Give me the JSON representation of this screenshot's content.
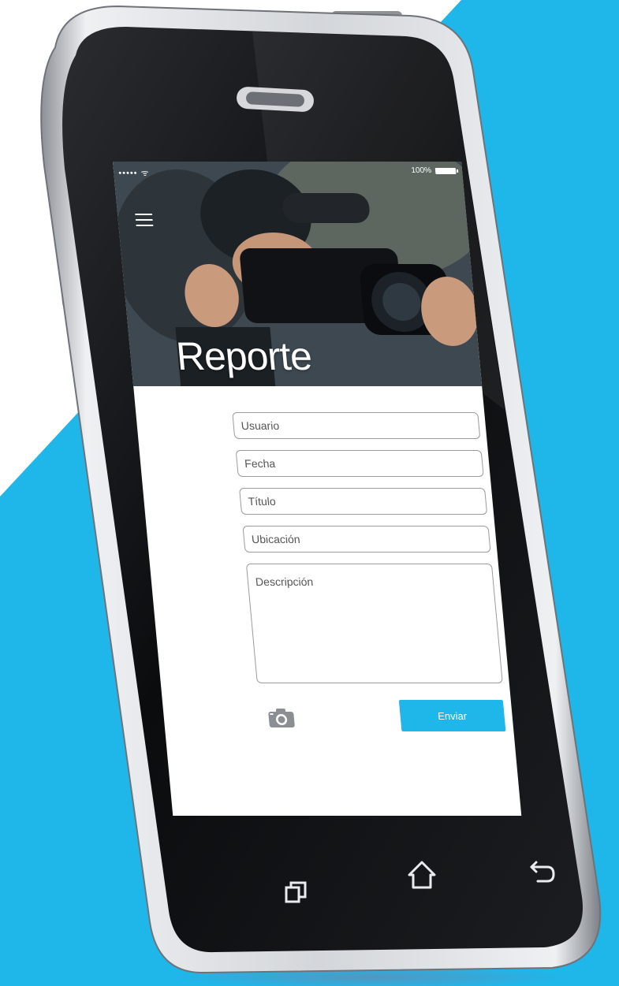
{
  "colors": {
    "accent_blue": "#1fb6ea",
    "background": "#ffffff",
    "phone_frame": "#c9ccd0",
    "phone_bezel": "#0e0f11"
  },
  "status_bar": {
    "signal": "••••• ᯤ",
    "battery_label": "100%"
  },
  "hero": {
    "title": "Reporte",
    "menu_icon": "hamburger-menu-icon"
  },
  "form": {
    "usuario_placeholder": "Usuario",
    "fecha_placeholder": "Fecha",
    "titulo_placeholder": "Título",
    "ubicacion_placeholder": "Ubicación",
    "descripcion_placeholder": "Descripción",
    "camera_icon": "camera-icon",
    "submit_label": "Enviar"
  },
  "nav_keys": {
    "recent": "recent-apps-icon",
    "home": "home-icon",
    "back": "back-icon"
  }
}
